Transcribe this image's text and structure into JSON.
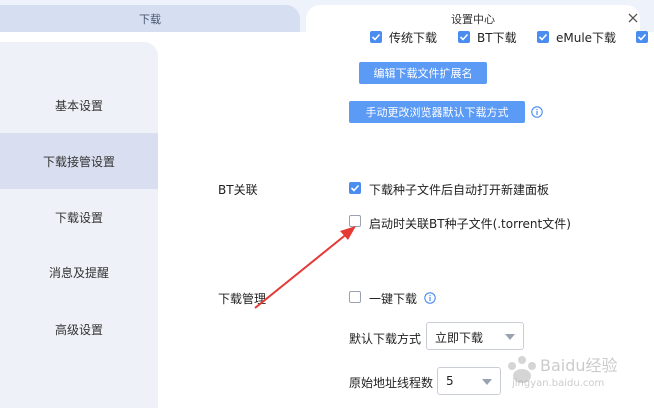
{
  "tabs": [
    {
      "label": "下载",
      "active": false
    },
    {
      "label": "设置中心",
      "active": true
    }
  ],
  "sidebar": {
    "items": [
      {
        "label": "基本设置",
        "active": false
      },
      {
        "label": "下载接管设置",
        "active": true
      },
      {
        "label": "下载设置",
        "active": false
      },
      {
        "label": "消息及提醒",
        "active": false
      },
      {
        "label": "高级设置",
        "active": false
      }
    ]
  },
  "top_checkboxes": [
    {
      "label": "传统下载",
      "checked": true
    },
    {
      "label": "BT下载",
      "checked": true
    },
    {
      "label": "eMule下载",
      "checked": true
    },
    {
      "label": "",
      "checked": true
    }
  ],
  "buttons": {
    "edit_ext": "编辑下载文件扩展名",
    "change_browser": "手动更改浏览器默认下载方式"
  },
  "bt_section": {
    "title": "BT关联",
    "options": [
      {
        "label": "下载种子文件后自动打开新建面板",
        "checked": true
      },
      {
        "label": "启动时关联BT种子文件(.torrent文件)",
        "checked": false
      }
    ]
  },
  "manage_section": {
    "title": "下载管理",
    "one_click": {
      "label": "一键下载",
      "checked": false
    },
    "default_mode": {
      "label": "默认下载方式",
      "value": "立即下载"
    },
    "threads": {
      "label": "原始地址线程数",
      "value": "5"
    }
  },
  "watermark": {
    "text": "Baidu经验",
    "sub": "jingyan.baidu.com"
  },
  "colors": {
    "accent": "#4a8cf0",
    "button": "#5b9af5",
    "arrow": "#e53935",
    "sidebar_bg": "#eef1f8",
    "sidebar_active": "#d9dff0"
  }
}
